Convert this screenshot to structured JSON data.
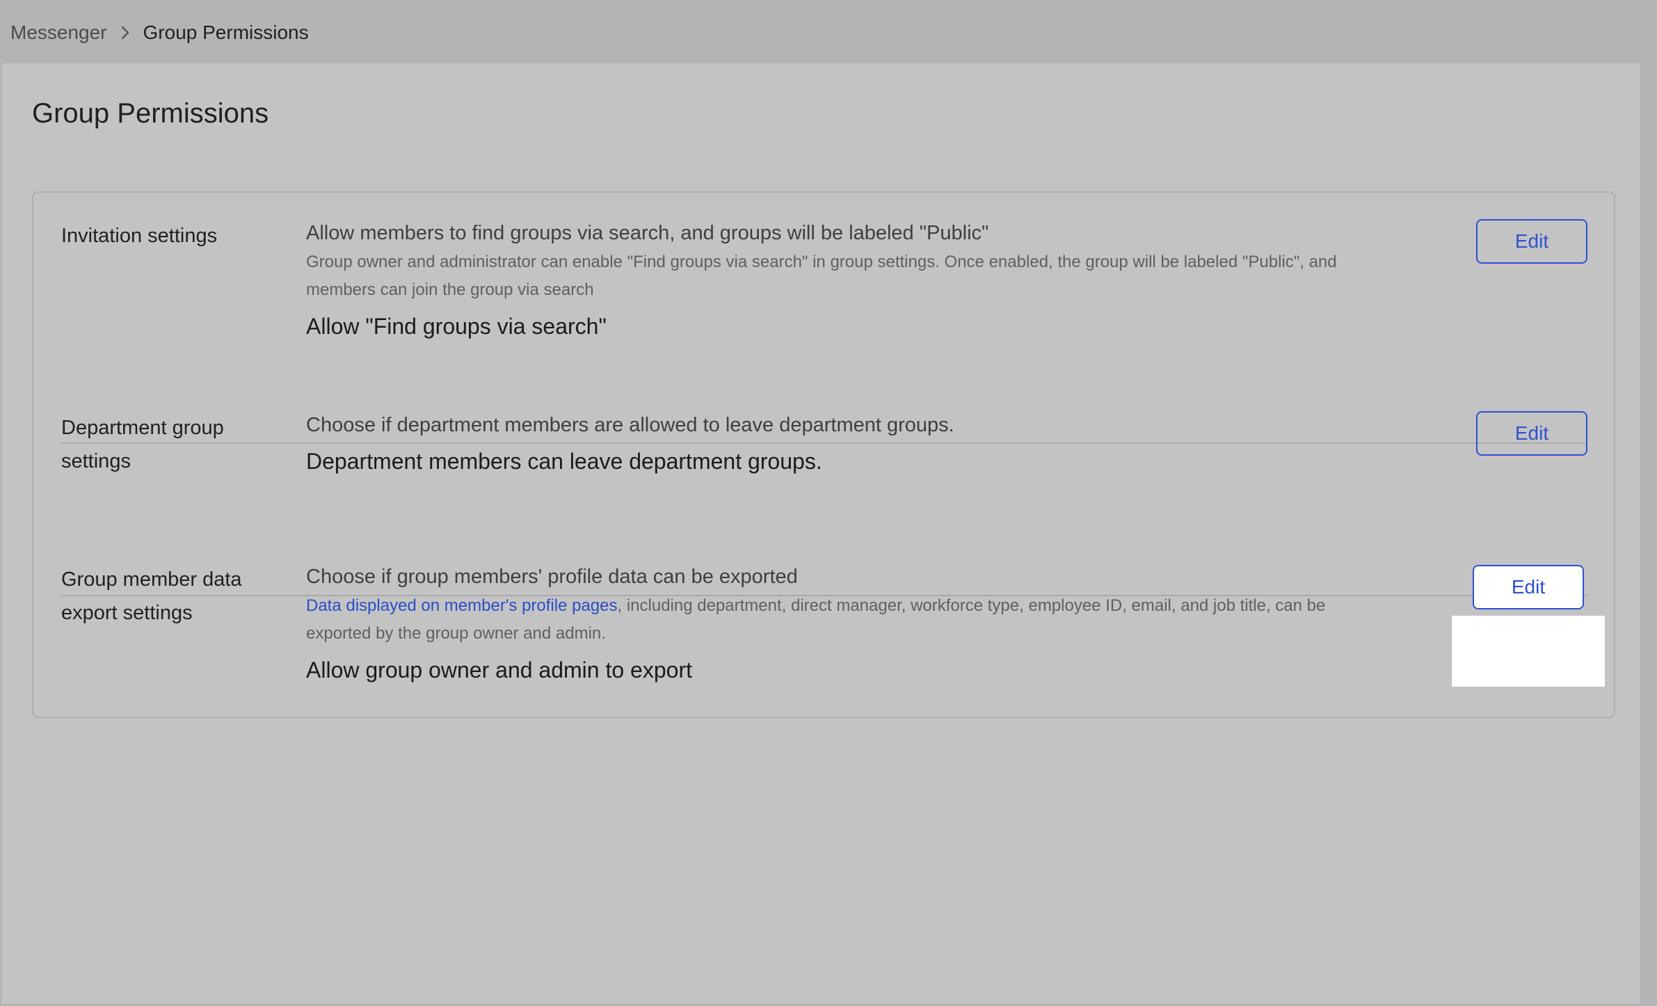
{
  "breadcrumb": {
    "parent": "Messenger",
    "current": "Group Permissions"
  },
  "page": {
    "title": "Group Permissions"
  },
  "settings": [
    {
      "label": "Invitation settings",
      "description": "Allow members to find groups via search, and groups will be labeled \"Public\"",
      "note": "Group owner and administrator can enable \"Find groups via search\" in group settings. Once enabled, the group will be labeled \"Public\", and members can join the group via search",
      "value": "Allow \"Find groups via search\"",
      "edit_label": "Edit"
    },
    {
      "label": "Department group settings",
      "description": "Choose if department members are allowed to leave department groups.",
      "value": "Department members can leave department groups.",
      "edit_label": "Edit"
    },
    {
      "label": "Group member data export settings",
      "description": "Choose if group members' profile data can be exported",
      "note_link": "Data displayed on member's profile pages",
      "note_rest": ", including department, direct manager, workforce type, employee ID, email, and job title, can be exported by the group owner and admin.",
      "value": "Allow group owner and admin to export",
      "edit_label": "Edit"
    }
  ],
  "colors": {
    "accent": "#2b52d4",
    "background": "#c3c3c3"
  }
}
